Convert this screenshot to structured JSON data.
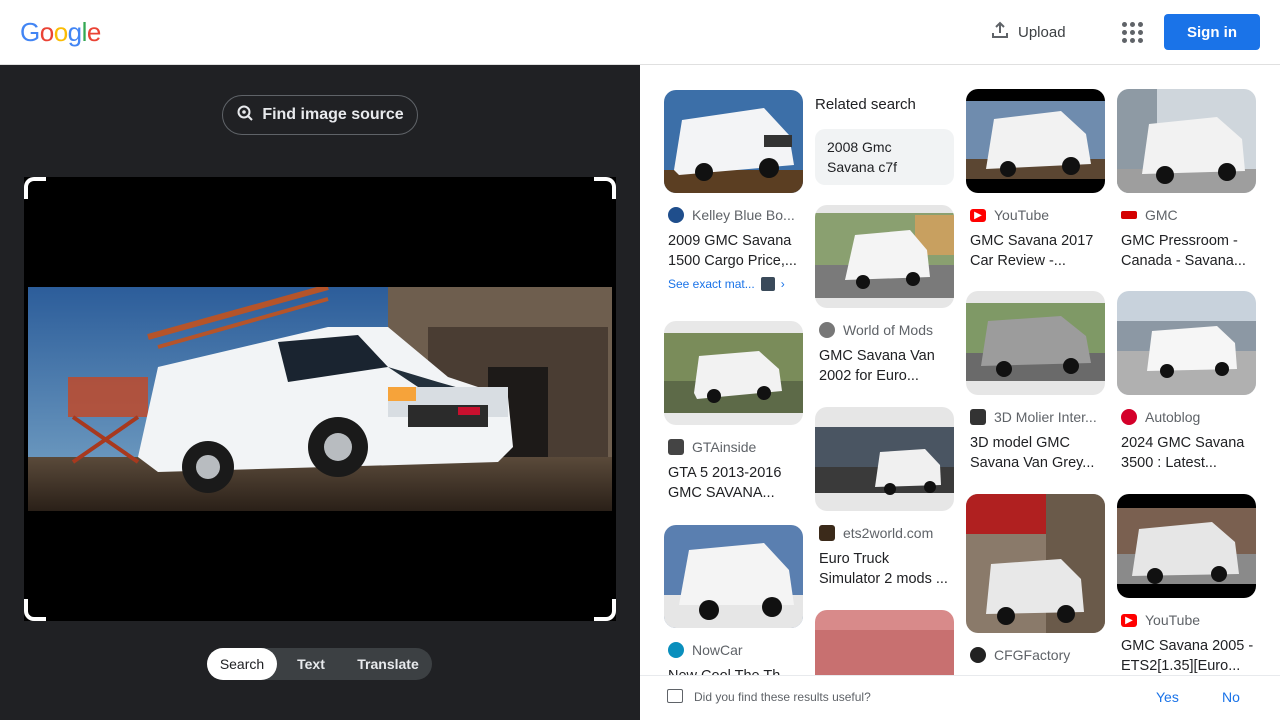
{
  "header": {
    "logo": [
      "G",
      "o",
      "o",
      "g",
      "l",
      "e"
    ],
    "logo_colors": [
      "#4285F4",
      "#EA4335",
      "#FBBC05",
      "#4285F4",
      "#34A853",
      "#EA4335"
    ],
    "upload_label": "Upload",
    "signin_label": "Sign in"
  },
  "left_panel": {
    "find_source_label": "Find image source",
    "modes": [
      "Search",
      "Text",
      "Translate"
    ],
    "active_mode": "Search"
  },
  "results": {
    "related_heading": "Related search",
    "related_chip": "2008 Gmc Savana c7f",
    "exact_match_label": "See exact mat...",
    "cards": [
      {
        "source": "Kelley Blue Bo...",
        "title": "2009 GMC Savana 1500 Cargo Price,...",
        "icon": "kbb-icon",
        "color": "#1f4e8c"
      },
      {
        "source": "GTAinside",
        "title": "GTA 5 2013-2016 GMC SAVANA...",
        "icon": "gtainside-icon",
        "color": "#444444"
      },
      {
        "source": "NowCar",
        "title": "New Cool The Th...",
        "icon": "nowcar-icon",
        "color": "#0a8fbd"
      },
      {
        "source": "World of Mods",
        "title": "GMC Savana Van 2002 for Euro...",
        "icon": "worldofmods-icon",
        "color": "#777777"
      },
      {
        "source": "ets2world.com",
        "title": "Euro Truck Simulator 2 mods ...",
        "icon": "ets2world-icon",
        "color": "#3b2a1a"
      },
      {
        "source": "YouTube",
        "title": "GMC Savana 2017 Car Review -...",
        "icon": "youtube-icon",
        "color": "#ff0000"
      },
      {
        "source": "3D Molier Inter...",
        "title": "3D model GMC Savana Van Grey...",
        "icon": "3dmolier-icon",
        "color": "#333333"
      },
      {
        "source": "CFGFactory",
        "title": "",
        "icon": "cfgfactory-icon",
        "color": "#222222"
      },
      {
        "source": "GMC",
        "title": "GMC Pressroom - Canada - Savana...",
        "icon": "gmc-icon",
        "color": "#d40000"
      },
      {
        "source": "Autoblog",
        "title": "2024 GMC Savana 3500 : Latest...",
        "icon": "autoblog-icon",
        "color": "#d4002a"
      },
      {
        "source": "YouTube",
        "title": "GMC Savana 2005 - ETS2[1.35][Euro...",
        "icon": "youtube-icon",
        "color": "#ff0000"
      }
    ]
  },
  "feedback": {
    "question": "Did you find these results useful?",
    "yes": "Yes",
    "no": "No"
  }
}
